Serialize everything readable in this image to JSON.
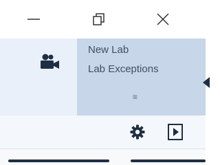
{
  "window_controls": {
    "minimize": "minimize",
    "restore": "restore",
    "close": "close"
  },
  "panel": {
    "icon": "video-camera-icon",
    "lab_title": "New Lab",
    "lab_subtitle": "Lab Exceptions",
    "menu_glyph": "≡"
  },
  "toolbar": {
    "settings_icon": "gear-icon",
    "play_icon": "play-icon"
  },
  "colors": {
    "panel_bg": "#e9f0f9",
    "highlight_bg": "#c7d6e8",
    "text": "#3f5163",
    "dark": "#1f2e43"
  }
}
